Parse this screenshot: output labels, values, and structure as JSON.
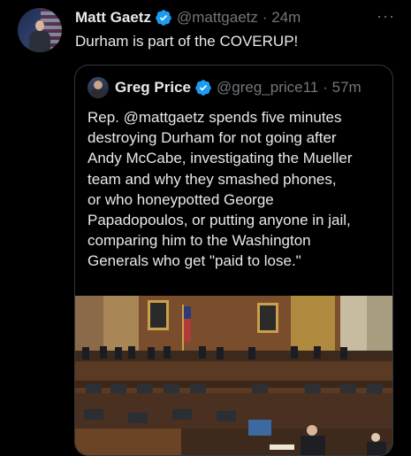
{
  "tweet": {
    "author_name": "Matt Gaetz",
    "handle": "@mattgaetz",
    "time": "· 24m",
    "text": "Durham is part of the COVERUP!",
    "more": "···"
  },
  "quoted_tweet": {
    "author_name": "Greg Price",
    "handle": "@greg_price11",
    "time": "· 57m",
    "text_lines": [
      "Rep. @mattgaetz spends five minutes",
      "destroying Durham for not going after",
      "Andy McCabe, investigating the Mueller",
      "team and why they smashed phones,",
      "or who honeypotted George",
      "Papadopoulos, or putting anyone in jail,",
      "comparing him to the Washington",
      "Generals who get \"paid to lose.\""
    ]
  },
  "colors": {
    "background": "#000000",
    "text": "#e7e9ea",
    "secondary": "#71767b",
    "verified": "#1d9bf0",
    "border": "#333639"
  },
  "icons": {
    "verified": "verified-badge-icon",
    "more": "more-options-icon"
  }
}
